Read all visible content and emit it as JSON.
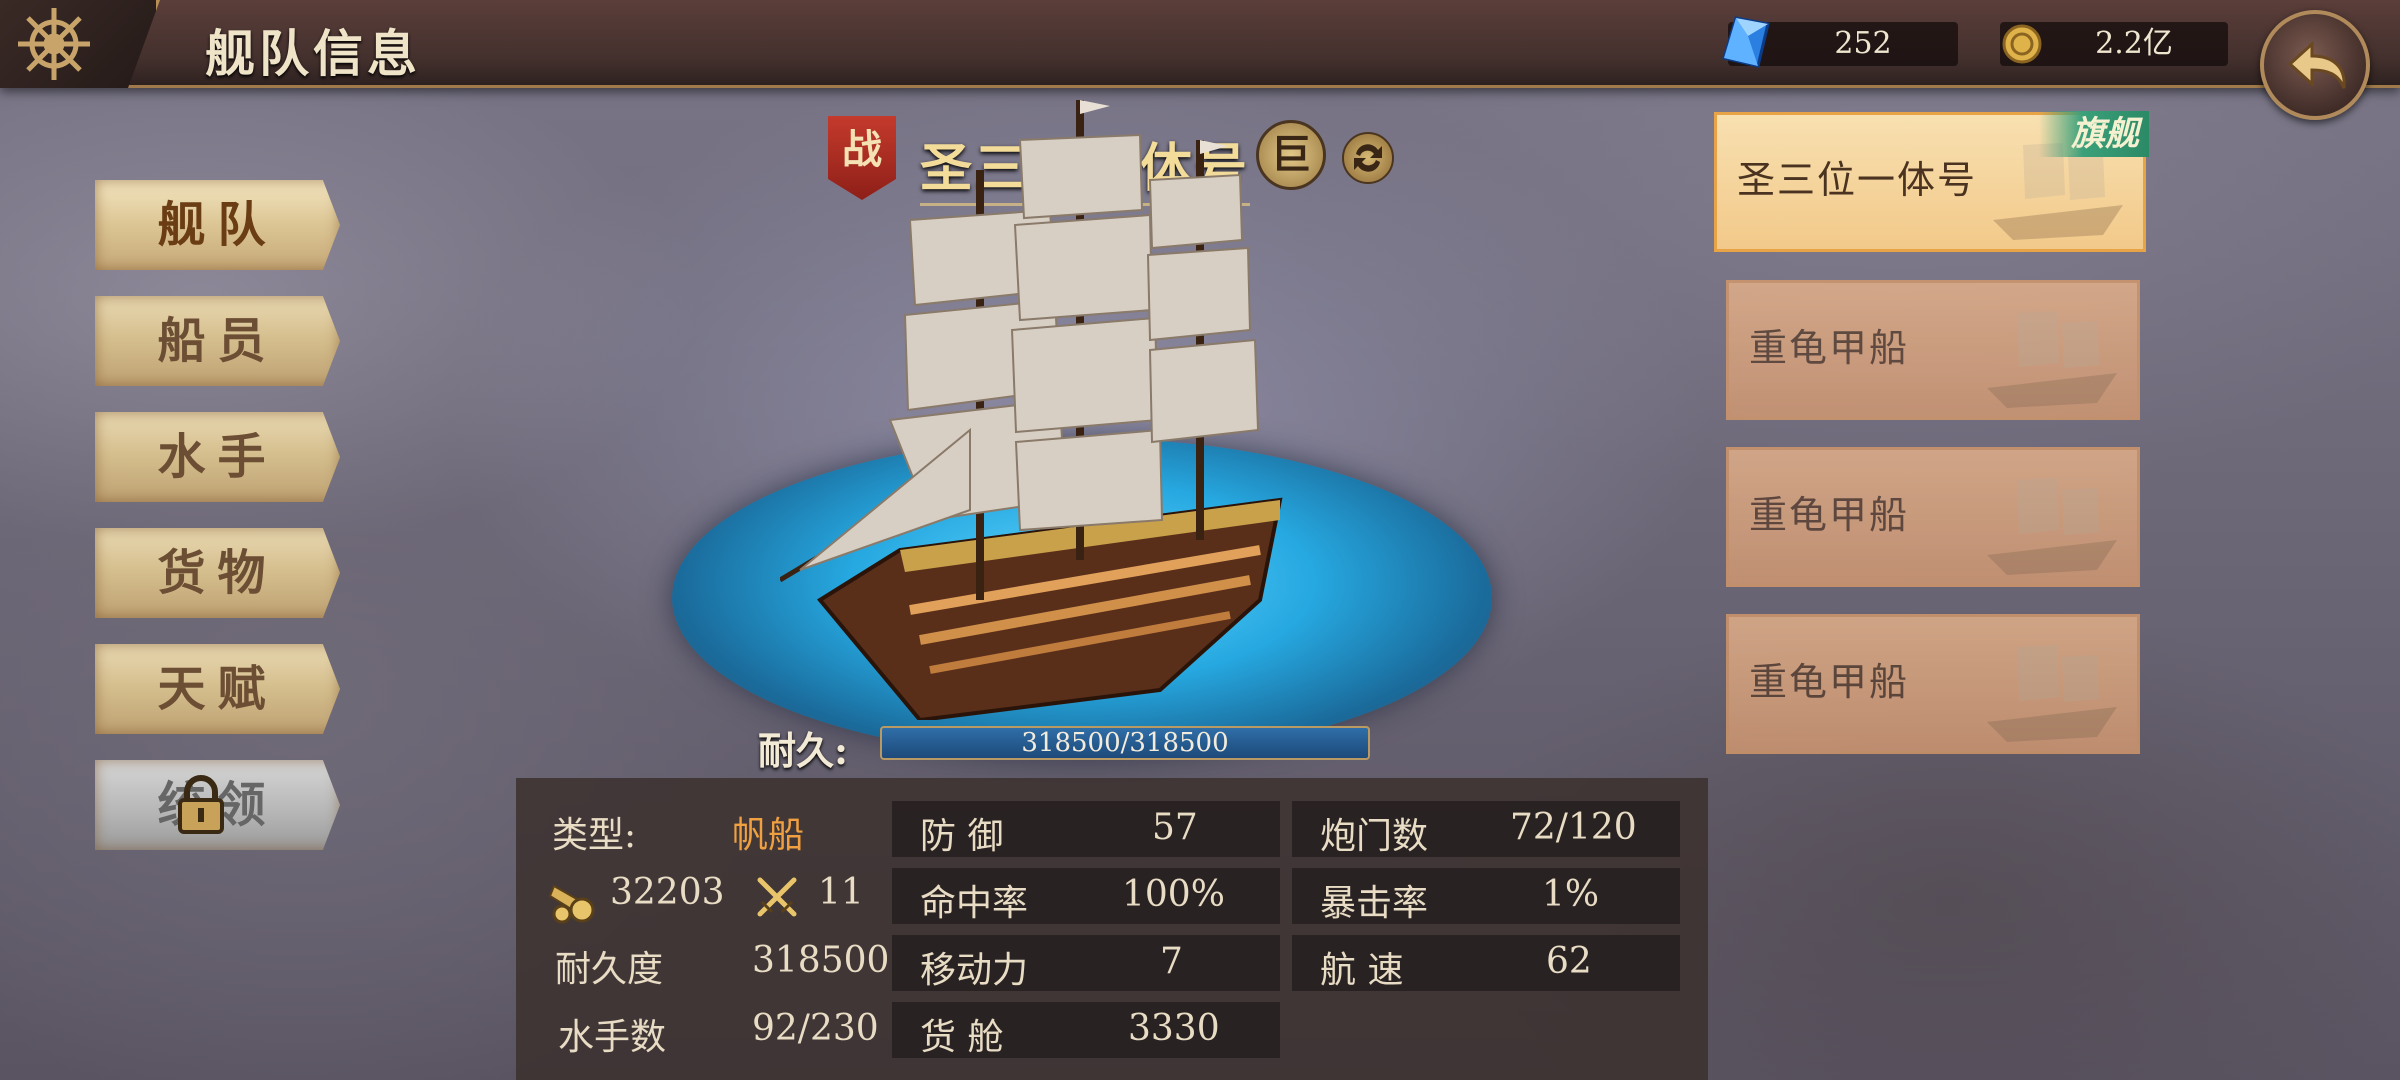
{
  "header": {
    "title": "舰队信息",
    "gems": "252",
    "gold": "2.2亿"
  },
  "nav": {
    "items": [
      {
        "label": "舰队",
        "active": true
      },
      {
        "label": "船员"
      },
      {
        "label": "水手"
      },
      {
        "label": "货物"
      },
      {
        "label": "天赋"
      },
      {
        "label": "统领",
        "locked": true
      }
    ]
  },
  "ship": {
    "battle_tag": "战",
    "name": "圣三位一体号",
    "class_tag": "巨",
    "durability_label": "耐久:",
    "durability_value": "318500/318500",
    "durability_fraction": 1.0
  },
  "stats": {
    "type_label": "类型:",
    "type_value": "帆船",
    "cannon_power": "32203",
    "melee_power": "11",
    "durability_label": "耐久度",
    "durability_value": "318500",
    "sailors_label": "水手数",
    "sailors_value": "92/230",
    "defense_label": "防 御",
    "defense_value": "57",
    "accuracy_label": "命中率",
    "accuracy_value": "100%",
    "mobility_label": "移动力",
    "mobility_value": "7",
    "cargo_label": "货 舱",
    "cargo_value": "3330",
    "gunports_label": "炮门数",
    "gunports_value": "72/120",
    "crit_label": "暴击率",
    "crit_value": "1%",
    "speed_label": "航 速",
    "speed_value": "62"
  },
  "fleet": {
    "flag_tag": "旗舰",
    "ships": [
      {
        "name": "圣三位一体号",
        "flagship": true
      },
      {
        "name": "重龟甲船"
      },
      {
        "name": "重龟甲船"
      },
      {
        "name": "重龟甲船"
      }
    ]
  },
  "icons": {
    "menu": "ship-wheel-icon",
    "gem": "blue-gem-icon",
    "gold": "gold-coin-icon",
    "back": "back-arrow-icon",
    "lock": "lock-icon",
    "swap": "swap-ship-icon",
    "cannon": "cannon-icon",
    "melee": "crossed-swords-icon"
  },
  "colors": {
    "accent_gold": "#f3dc9a",
    "type_orange": "#f0a040",
    "durability_blue": "#2f6ea8",
    "flagship_card": "#f2c98a",
    "flag_tag_green": "#2c8a66"
  }
}
